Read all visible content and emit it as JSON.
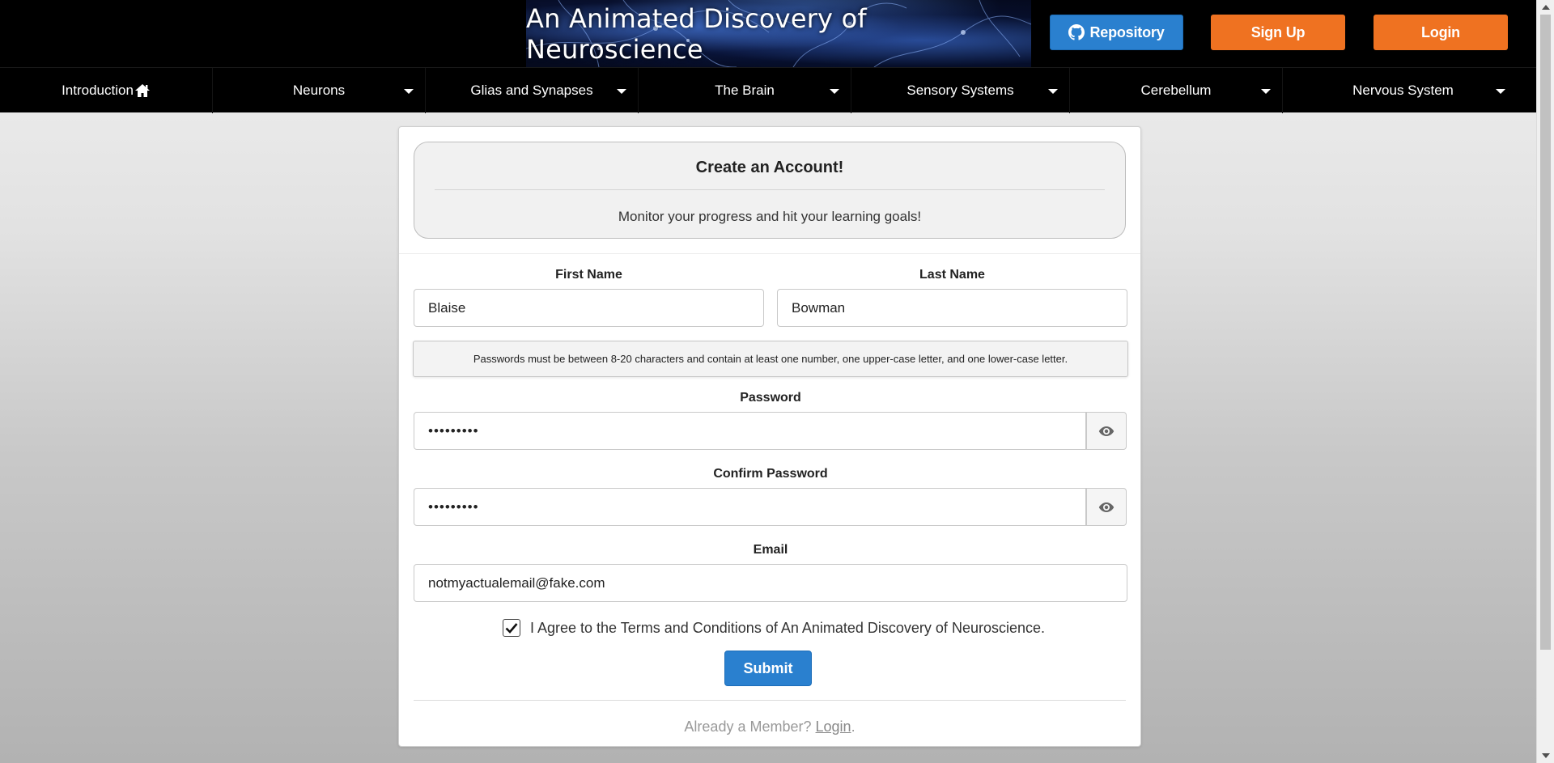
{
  "header": {
    "banner_title": "An Animated Discovery of Neuroscience",
    "repository_label": "Repository",
    "signup_label": "Sign Up",
    "login_label": "Login"
  },
  "nav": {
    "items": [
      {
        "label": "Introduction",
        "icon": "home-icon"
      },
      {
        "label": "Neurons",
        "icon": "caret-down-icon"
      },
      {
        "label": "Glias and Synapses",
        "icon": "caret-down-icon"
      },
      {
        "label": "The Brain",
        "icon": "caret-down-icon"
      },
      {
        "label": "Sensory Systems",
        "icon": "caret-down-icon"
      },
      {
        "label": "Cerebellum",
        "icon": "caret-down-icon"
      },
      {
        "label": "Nervous System",
        "icon": "caret-down-icon"
      }
    ]
  },
  "form": {
    "title": "Create an Account!",
    "subtitle": "Monitor your progress and hit your learning goals!",
    "first_name_label": "First Name",
    "first_name_value": "Blaise",
    "last_name_label": "Last Name",
    "last_name_value": "Bowman",
    "password_note": "Passwords must be between 8-20 characters and contain at least one number, one upper-case letter, and one lower-case letter.",
    "password_label": "Password",
    "password_value": "•••••••••",
    "confirm_password_label": "Confirm Password",
    "confirm_password_value": "•••••••••",
    "email_label": "Email",
    "email_value": "notmyactualemail@fake.com",
    "terms_text": "I Agree to the Terms and Conditions of An Animated Discovery of Neuroscience.",
    "terms_checked": true,
    "submit_label": "Submit",
    "member_prompt": "Already a Member?",
    "member_login_link": "Login",
    "member_suffix": "."
  },
  "colors": {
    "primary_blue": "#2a80cf",
    "accent_orange": "#ef7221",
    "header_bg": "#000000"
  }
}
